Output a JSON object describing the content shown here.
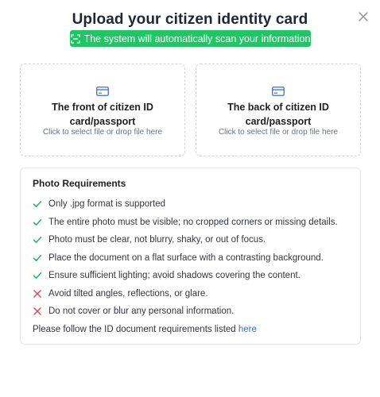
{
  "modal": {
    "title": "Upload your citizen identity card",
    "badge_text": "The system will automatically scan your information",
    "accent_color": "#1ec764",
    "link_color": "#2f6fe0"
  },
  "upload": {
    "front": {
      "label": "The front of citizen ID card/passport",
      "hint": "Click to select file or drop file here"
    },
    "back": {
      "label": "The back of citizen ID card/passport",
      "hint": "Click to select file or drop file here"
    }
  },
  "requirements": {
    "title": "Photo Requirements",
    "items": [
      {
        "text": "Only .jpg format is supported",
        "ok": true
      },
      {
        "text": "The entire photo must be visible; no cropped corners or missing details.",
        "ok": true
      },
      {
        "text": "Photo must be clear, not blurry, shaky, or out of focus.",
        "ok": true
      },
      {
        "text": "Place the document on a flat surface with a contrasting background.",
        "ok": true
      },
      {
        "text": "Ensure sufficient lighting; avoid shadows covering the content.",
        "ok": true
      },
      {
        "text": "Avoid tilted angles, reflections, or glare.",
        "ok": false
      },
      {
        "text": "Do not cover or blur any personal information.",
        "ok": false
      }
    ],
    "note_prefix": "Please follow the ID document requirements listed ",
    "note_link": "here"
  },
  "icons": {
    "close": "close-icon",
    "scan": "scan-icon",
    "card": "card-icon",
    "check": "check-icon",
    "cross": "cross-icon"
  }
}
